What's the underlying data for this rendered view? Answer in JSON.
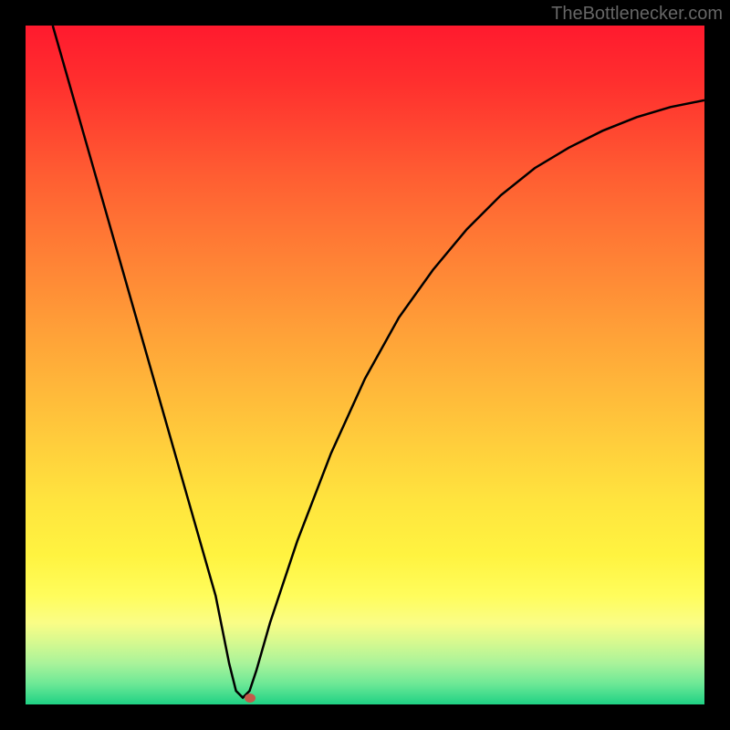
{
  "watermark": "TheBottlenecker.com",
  "chart_data": {
    "type": "line",
    "title": "",
    "xlabel": "",
    "ylabel": "",
    "xlim": [
      0,
      100
    ],
    "ylim": [
      0,
      100
    ],
    "series": [
      {
        "name": "bottleneck-curve",
        "x": [
          4,
          8,
          12,
          16,
          20,
          24,
          28,
          30,
          31,
          32,
          33,
          34,
          36,
          40,
          45,
          50,
          55,
          60,
          65,
          70,
          75,
          80,
          85,
          90,
          95,
          100
        ],
        "values": [
          100,
          86,
          72,
          58,
          44,
          30,
          16,
          6,
          2,
          1,
          2,
          5,
          12,
          24,
          37,
          48,
          57,
          64,
          70,
          75,
          79,
          82,
          84.5,
          86.5,
          88,
          89
        ]
      }
    ],
    "marker": {
      "x": 33,
      "y": 1
    },
    "gradient_colors": {
      "top": "#ff1a2e",
      "middle": "#ffe43e",
      "bottom": "#1fd184"
    }
  }
}
